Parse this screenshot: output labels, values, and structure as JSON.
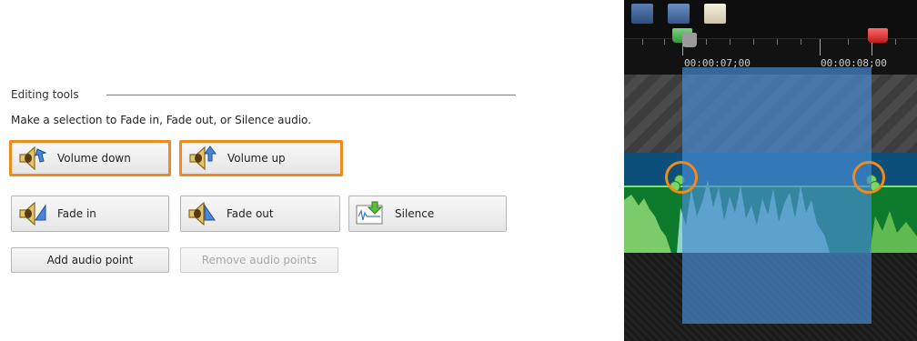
{
  "editing_tools": {
    "group_title": "Editing tools",
    "hint": "Make a selection to Fade in, Fade out, or Silence audio.",
    "buttons": {
      "volume_down": "Volume down",
      "volume_up": "Volume up",
      "fade_in": "Fade in",
      "fade_out": "Fade out",
      "silence": "Silence",
      "add_audio_point": "Add audio point",
      "remove_audio_points": "Remove audio points"
    },
    "highlight_color": "#f08a1c"
  },
  "timeline": {
    "time_labels": [
      "00:00:07;00",
      "00:00:08;00"
    ],
    "colors": {
      "selection": "#468cd2",
      "audio_track": "#0d7a2e",
      "volume_band": "#0c4f7a",
      "start_marker": "#3cb44b",
      "end_marker": "#d22323"
    }
  }
}
